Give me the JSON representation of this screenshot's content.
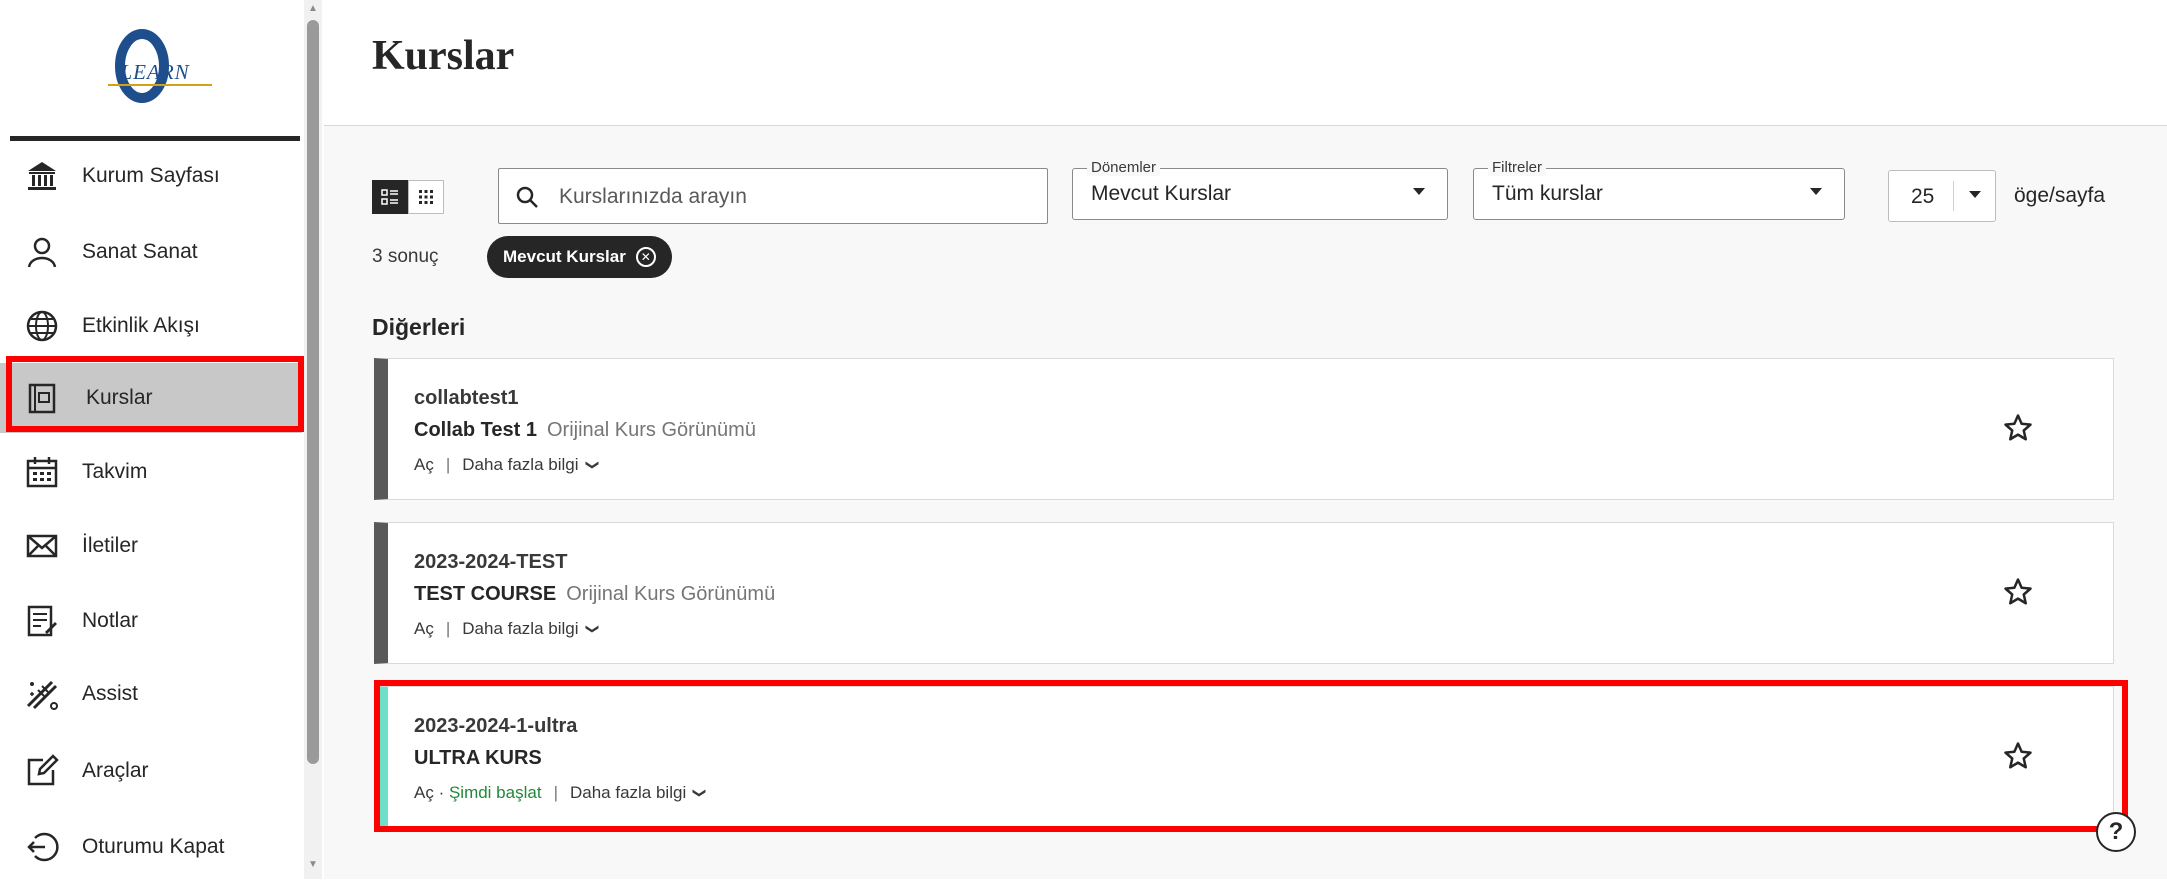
{
  "logo": {
    "text": "'LEARN",
    "letter": "O"
  },
  "sidebar": {
    "items": [
      {
        "label": "Kurum Sayfası",
        "icon": "institution-icon"
      },
      {
        "label": "Sanat Sanat",
        "icon": "user-icon"
      },
      {
        "label": "Etkinlik Akışı",
        "icon": "globe-icon"
      },
      {
        "label": "Kurslar",
        "icon": "courses-icon"
      },
      {
        "label": "Takvim",
        "icon": "calendar-icon"
      },
      {
        "label": "İletiler",
        "icon": "envelope-icon"
      },
      {
        "label": "Notlar",
        "icon": "grades-icon"
      },
      {
        "label": "Assist",
        "icon": "assist-icon"
      },
      {
        "label": "Araçlar",
        "icon": "tools-icon"
      },
      {
        "label": "Oturumu Kapat",
        "icon": "logout-icon"
      }
    ]
  },
  "header": {
    "title": "Kurslar"
  },
  "toolbar": {
    "search_placeholder": "Kurslarınızda arayın",
    "terms": {
      "legend": "Dönemler",
      "value": "Mevcut Kurslar"
    },
    "filters": {
      "legend": "Filtreler",
      "value": "Tüm kurslar"
    },
    "per_page": {
      "value": "25",
      "label": "öge/sayfa"
    }
  },
  "results": {
    "count": "3 sonuç",
    "chip": "Mevcut Kurslar"
  },
  "section": {
    "title": "Diğerleri"
  },
  "courses": [
    {
      "id": "collabtest1",
      "name": "Collab Test 1",
      "view": "Orijinal Kurs Görünümü",
      "open": "Aç",
      "start": "",
      "more": "Daha fazla bilgi"
    },
    {
      "id": "2023-2024-TEST",
      "name": "TEST COURSE",
      "view": "Orijinal Kurs Görünümü",
      "open": "Aç",
      "start": "",
      "more": "Daha fazla bilgi"
    },
    {
      "id": "2023-2024-1-ultra",
      "name": "ULTRA KURS",
      "view": "",
      "open": "Aç",
      "start": "Şimdi başlat",
      "more": "Daha fazla bilgi"
    }
  ],
  "help": {
    "label": "?"
  },
  "colors": {
    "highlight": "#ff0000",
    "ultra_accent": "#6ee0c9",
    "original_accent": "#595959",
    "start_link": "#1f8a38"
  }
}
